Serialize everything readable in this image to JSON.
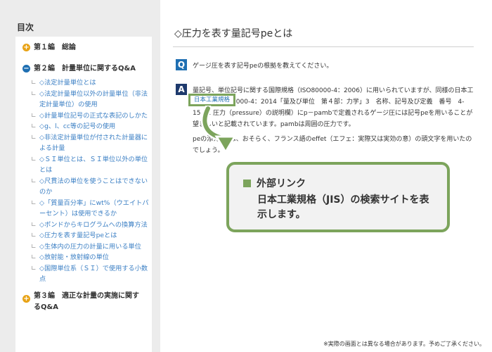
{
  "sidebar": {
    "title": "目次",
    "sections": [
      {
        "label": "第１編　総論",
        "state": "collapsed"
      },
      {
        "label": "第２編　計量単位に関するQ&A",
        "state": "expanded"
      },
      {
        "label": "第３編　適正な計量の実施に関するQ&A",
        "state": "collapsed"
      }
    ],
    "items": [
      "◇法定計量単位とは",
      "◇法定計量単位以外の計量単位（非法定計量単位）の使用",
      "◇計量単位記号の正式な表記のしかた",
      "◇g、l、cc等の記号の使用",
      "◇非法定計量単位が付された計量器による計量",
      "◇ＳＩ単位とは、ＳＩ単位以外の単位とは",
      "◇尺貫法の単位を使うことはできないのか",
      "◇「質量百分率」にwt%（ウエイトパーセント）は使用できるか",
      "◇ポンドからキログラムへの換算方法",
      "◇圧力を表す量記号peとは",
      "◇生体内の圧力の計量に用いる単位",
      "◇放射能・放射線の単位",
      "◇国際単位系（ＳＩ）で使用する小数点"
    ]
  },
  "main": {
    "title": "◇圧力を表す量記号peとは",
    "q_badge": "Q",
    "question": "ゲージ圧を表す記号peの根拠を教えてください。",
    "a_badge": "A",
    "answer_p1": "量記号、単位記号に関する国際規格（ISO80000-4：2006）に用いられていますが、同様の日本工業規格（JIS Z8000-4：2014「量及び単位　第４部：力学」3　名称、記号及び定義　番号　4-15．1 圧力（pressure）の説明欄）にp－pambで定義されるゲージ圧には記号peを用いることが望ましいと記載されています。pambは周囲の圧力です。",
    "answer_p2": "peの添え字eは、おそらく、フランス語のeffet（エフェ：実際又は実効の意）の頭文字を用いたのでしょう。",
    "jis_link": "日本工業規格"
  },
  "callout": {
    "heading": "外部リンク",
    "body": "日本工業規格（JIS）の検索サイトを表示します。"
  },
  "footnote": "※実際の画面とは異なる場合があります。予めご了承ください。",
  "colors": {
    "accent_green": "#7ca45c",
    "link_blue": "#3b7fc4",
    "q_blue": "#1f6fb2",
    "a_navy": "#1e3a6d",
    "plus_orange": "#e8a317"
  }
}
